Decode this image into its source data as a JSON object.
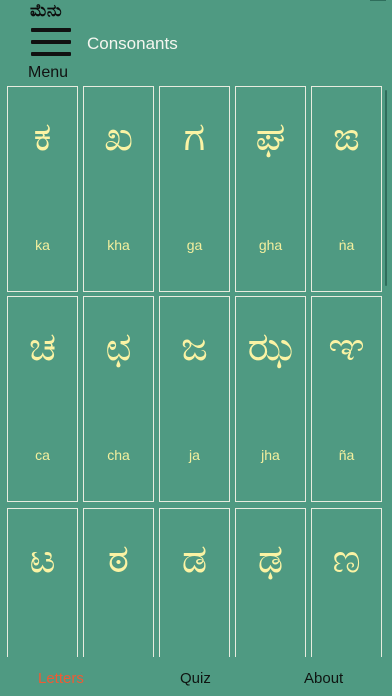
{
  "header": {
    "menu_native": "ಮೆನು",
    "menu_label": "Menu",
    "title": "Consonants"
  },
  "letters": [
    {
      "glyph": "ಕ",
      "roman": "ka"
    },
    {
      "glyph": "ಖ",
      "roman": "kha"
    },
    {
      "glyph": "ಗ",
      "roman": "ga"
    },
    {
      "glyph": "ಘ",
      "roman": "gha"
    },
    {
      "glyph": "ಙ",
      "roman": "ṅa"
    },
    {
      "glyph": "ಚ",
      "roman": "ca"
    },
    {
      "glyph": "ಛ",
      "roman": "cha"
    },
    {
      "glyph": "ಜ",
      "roman": "ja"
    },
    {
      "glyph": "ಝ",
      "roman": "jha"
    },
    {
      "glyph": "ಞ",
      "roman": "ña"
    },
    {
      "glyph": "ಟ",
      "roman": ""
    },
    {
      "glyph": "ಠ",
      "roman": ""
    },
    {
      "glyph": "ಡ",
      "roman": ""
    },
    {
      "glyph": "ಢ",
      "roman": ""
    },
    {
      "glyph": "ಣ",
      "roman": ""
    }
  ],
  "tabs": [
    {
      "label": "Letters",
      "active": true
    },
    {
      "label": "Quiz",
      "active": false
    },
    {
      "label": "About",
      "active": false
    }
  ],
  "colors": {
    "background": "#4f9a82",
    "glyph": "#fbf3a4",
    "cell_border": "#e8ecdf",
    "active_tab": "#ef5a34",
    "inactive_tab": "#0f1411"
  }
}
